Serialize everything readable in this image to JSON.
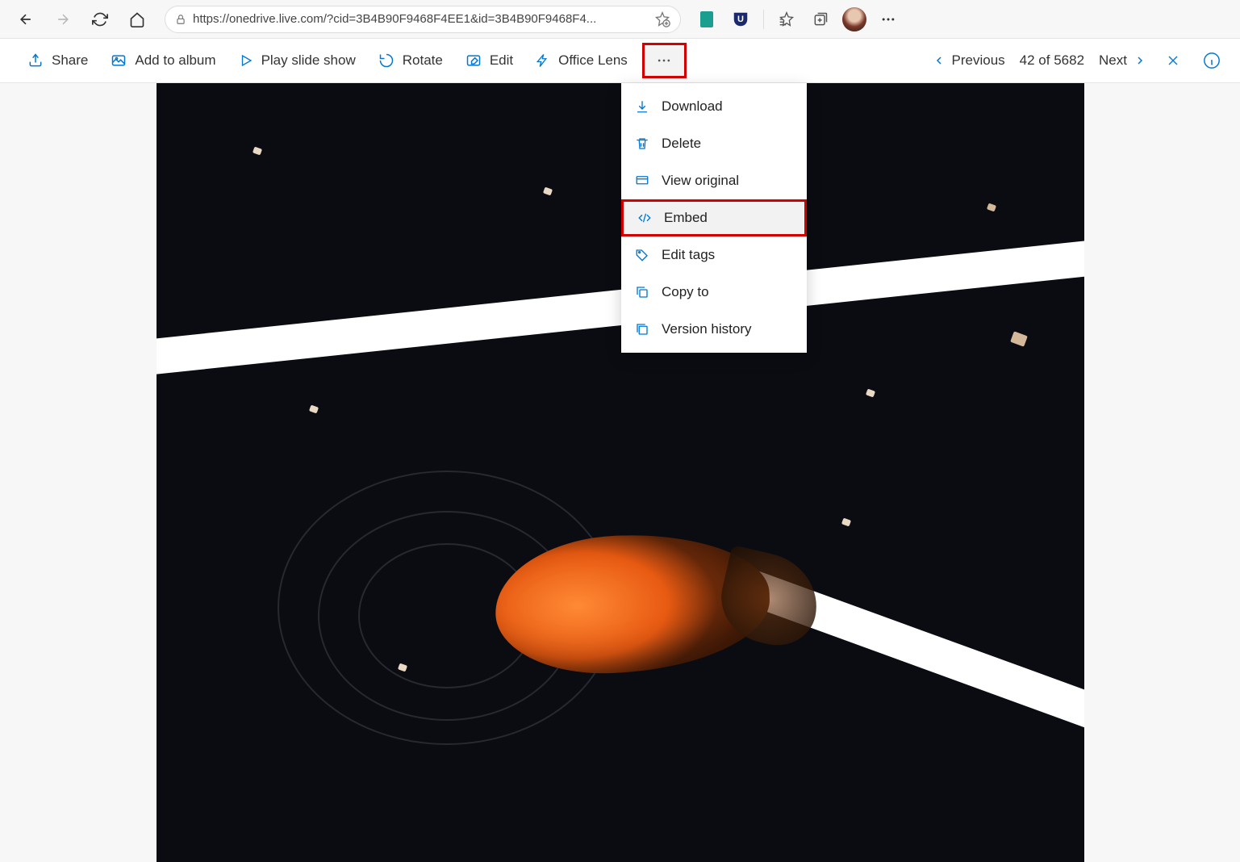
{
  "browser": {
    "url": "https://onedrive.live.com/?cid=3B4B90F9468F4EE1&id=3B4B90F9468F4..."
  },
  "toolbar": {
    "share": "Share",
    "add_to_album": "Add to album",
    "play_slideshow": "Play slide show",
    "rotate": "Rotate",
    "edit": "Edit",
    "office_lens": "Office Lens"
  },
  "nav": {
    "previous": "Previous",
    "counter": "42 of 5682",
    "next": "Next"
  },
  "menu": {
    "download": "Download",
    "delete": "Delete",
    "view_original": "View original",
    "embed": "Embed",
    "edit_tags": "Edit tags",
    "copy_to": "Copy to",
    "version_history": "Version history"
  }
}
